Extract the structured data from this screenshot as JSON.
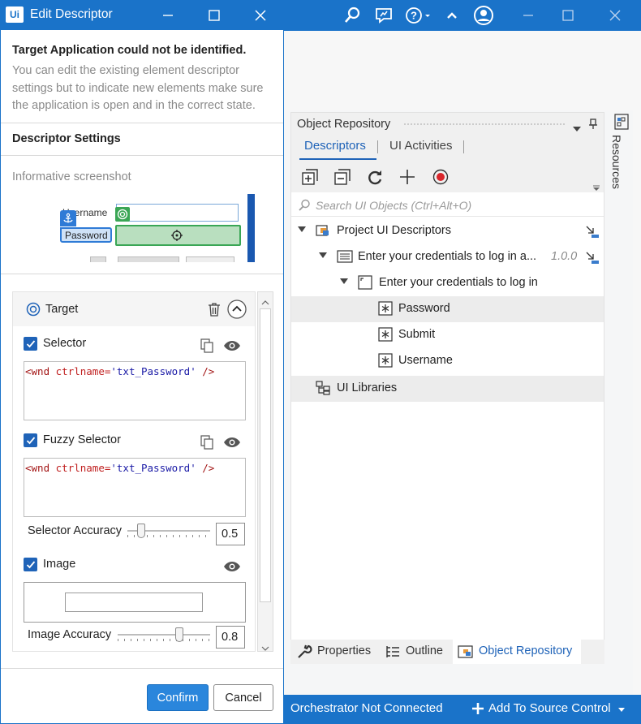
{
  "colors": {
    "accent": "#1a73c9",
    "selected_row": "#ececec",
    "check": "#1f63b8",
    "record": "#d9262b"
  },
  "dialog": {
    "logo": "Ui",
    "title": "Edit Descriptor",
    "warning_title": "Target Application could not be identified.",
    "warning_text": "You can edit the existing element descriptor settings but to indicate new elements make sure the application is open and in the correct state.",
    "settings_title": "Descriptor Settings",
    "screenshot_label": "Informative screenshot",
    "screenshot": {
      "username_label": "Username",
      "password_label": "Password"
    },
    "target_label": "Target",
    "selector": {
      "checked": true,
      "label": "Selector",
      "code_tag_open": "<wnd",
      "code_attr": "ctrlname=",
      "code_value": "'txt_Password'",
      "code_tag_close": "/>"
    },
    "fuzzy_selector": {
      "checked": true,
      "label": "Fuzzy Selector",
      "code_tag_open": "<wnd",
      "code_attr": "ctrlname=",
      "code_value": "'txt_Password'",
      "code_tag_close": "/>"
    },
    "selector_accuracy": {
      "label": "Selector Accuracy",
      "value": "0.5"
    },
    "image": {
      "checked": true,
      "label": "Image"
    },
    "image_accuracy": {
      "label": "Image Accuracy",
      "value": "0.8"
    },
    "confirm_label": "Confirm",
    "cancel_label": "Cancel"
  },
  "repo": {
    "title": "Object Repository",
    "tabs": [
      "Descriptors",
      "UI Activities"
    ],
    "search_placeholder": "Search UI Objects (Ctrl+Alt+O)",
    "tree": [
      {
        "label": "Project UI Descriptors"
      },
      {
        "label": "Enter your credentials to log in a...",
        "version": "1.0.0"
      },
      {
        "label": "Enter your credentials to log in"
      },
      {
        "label": "Password",
        "selected": true
      },
      {
        "label": "Submit"
      },
      {
        "label": "Username"
      },
      {
        "label": "UI Libraries"
      }
    ],
    "bottom_tabs": [
      "Properties",
      "Outline",
      "Object Repository"
    ]
  },
  "resources_label": "Resources",
  "status": {
    "left": "Orchestrator Not Connected",
    "right": "Add To Source Control"
  }
}
